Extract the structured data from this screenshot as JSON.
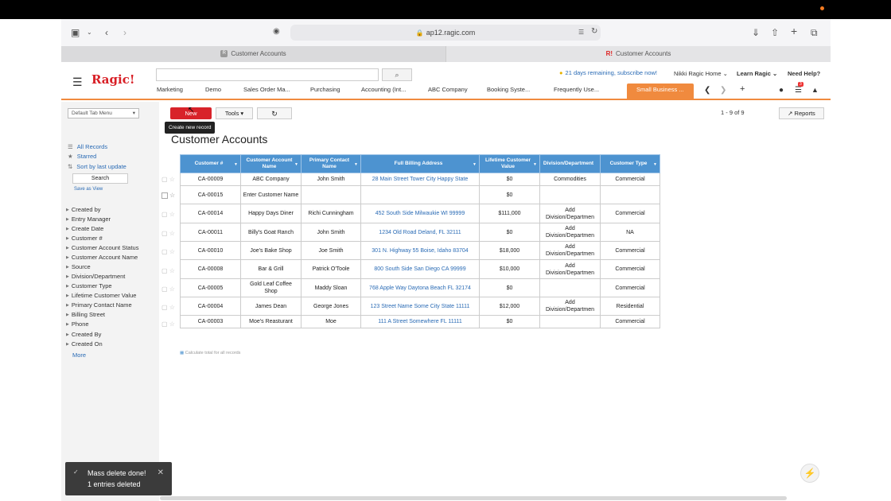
{
  "browser": {
    "url": "ap12.ragic.com",
    "tabs": [
      {
        "favicon": "R",
        "title": "Customer Accounts"
      },
      {
        "favicon": "R!",
        "title": "Customer Accounts"
      }
    ]
  },
  "app": {
    "logo": "Ragic!",
    "search_button": "⌕",
    "trial_notice": "21 days remaining, subscribe now!",
    "user_menu": "Nikki Ragic Home ⌄",
    "learn_menu": "Learn Ragic ⌄",
    "help_link": "Need Help?",
    "notification_count": "3",
    "tabs": [
      "Marketing",
      "Demo",
      "Sales Order Ma...",
      "Purchasing",
      "Accounting (Int...",
      "ABC Company",
      "Booking Syste...",
      "Frequently Use...",
      "Small Business ..."
    ],
    "active_tab": "Small Business ..."
  },
  "sidebar": {
    "tab_menu": "Default Tab Menu",
    "links": [
      "All Records",
      "Starred",
      "Sort by last update"
    ],
    "search_button": "Search",
    "save_as_view": "Save as View",
    "facets": [
      "Created by",
      "Entry Manager",
      "Create Date",
      "Customer #",
      "Customer Account Status",
      "Customer Account Name",
      "Source",
      "Division/Department",
      "Customer Type",
      "Lifetime Customer Value",
      "Primary Contact Name",
      "Billing Street",
      "Phone",
      "Created By",
      "Created On"
    ],
    "more_link": "More"
  },
  "toolbar": {
    "new_label": "New",
    "new_tooltip": "Create new record",
    "tools_label": "Tools ▾",
    "refresh_icon": "↻",
    "pager": "1 - 9 of 9",
    "reports_label": "Reports"
  },
  "page": {
    "title": "Customer Accounts",
    "calc_total": "Calculate total for all records"
  },
  "table": {
    "headers": [
      "Customer #",
      "Customer Account Name",
      "Primary Contact Name",
      "Full Billing Address",
      "Lifetime Customer Value",
      "Division/Department",
      "Customer Type"
    ],
    "rows": [
      [
        "CA-00009",
        "ABC Company",
        "John Smith",
        "28 Main Street Tower City Happy State",
        "$0",
        "Commodities",
        "Commercial"
      ],
      [
        "CA-00015",
        "Enter Customer Name",
        "",
        "",
        "$0",
        "",
        ""
      ],
      [
        "CA-00014",
        "Happy Days Diner",
        "Richi Cunningham",
        "452 South Side Milwaukie WI 99999",
        "$111,000",
        "Add Division/Departmen",
        "Commercial"
      ],
      [
        "CA-00011",
        "Billy's Goat Ranch",
        "John Smith",
        "1234 Old Road Deland, FL 32111",
        "$0",
        "Add Division/Departmen",
        "NA"
      ],
      [
        "CA-00010",
        "Joe's Bake Shop",
        "Joe Smith",
        "301 N. Highway 55 Boise, Idaho 83704",
        "$18,000",
        "Add Division/Departmen",
        "Commercial"
      ],
      [
        "CA-00008",
        "Bar & Grill",
        "Patrick O'Toole",
        "800 South Side San Diego CA 99999",
        "$10,000",
        "Add Division/Departmen",
        "Commercial"
      ],
      [
        "CA-00005",
        "Gold Leaf Coffee Shop",
        "Maddy Sloan",
        "768 Apple Way Daytona Beach FL 32174",
        "$0",
        "",
        "Commercial"
      ],
      [
        "CA-00004",
        "James Dean",
        "George Jones",
        "123 Street Name Some City State 11111",
        "$12,000",
        "Add Division/Departmen",
        "Residential"
      ],
      [
        "CA-00003",
        "Moe's Reasturant",
        "Moe",
        "111 A Street Somewhere FL 11111",
        "$0",
        "",
        "Commercial"
      ]
    ]
  },
  "toast": {
    "line1": "Mass delete done!",
    "line2": "1 entries deleted"
  },
  "colors": {
    "brand_red": "#d8232a",
    "accent_orange": "#f08a3e",
    "header_blue": "#4d93d0",
    "link_blue": "#2a6bb5"
  }
}
